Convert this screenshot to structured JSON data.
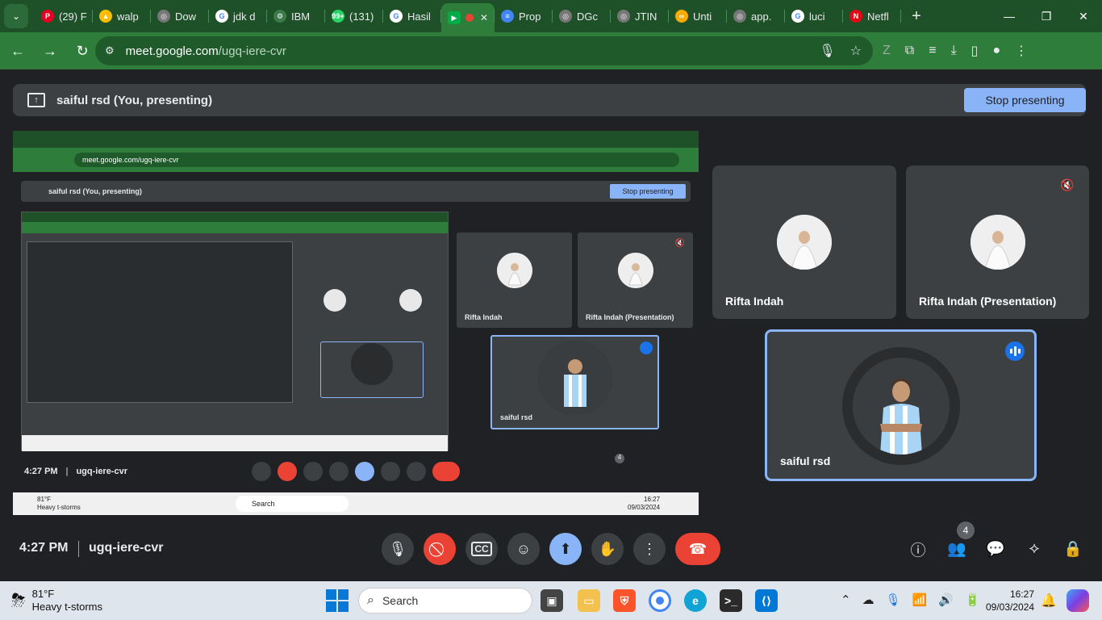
{
  "browser": {
    "tabs": [
      {
        "label": "(29) F",
        "icon": "pinterest-icon",
        "color": "#e60023",
        "glyph": "P"
      },
      {
        "label": "walp",
        "icon": "drive-icon",
        "color": "#fbbc04",
        "glyph": "▲"
      },
      {
        "label": "Dow",
        "icon": "globe-icon",
        "color": "#777777",
        "glyph": "◎"
      },
      {
        "label": "jdk d",
        "icon": "google-icon",
        "color": "#ffffff",
        "glyph": "G"
      },
      {
        "label": "IBM",
        "icon": "ibm-icon",
        "color": "#3d7a4a",
        "glyph": "⚙"
      },
      {
        "label": "(131)",
        "icon": "whatsapp-icon",
        "color": "#25d366",
        "glyph": "99+"
      },
      {
        "label": "Hasil",
        "icon": "google-icon",
        "color": "#ffffff",
        "glyph": "G"
      }
    ],
    "active_tab_close": "✕",
    "tabs_after": [
      {
        "label": "Prop",
        "icon": "docs-icon",
        "color": "#4285f4",
        "glyph": "≡"
      },
      {
        "label": "DGc",
        "icon": "globe-icon",
        "color": "#777777",
        "glyph": "◎"
      },
      {
        "label": "JTIN",
        "icon": "globe-icon",
        "color": "#777777",
        "glyph": "◎"
      },
      {
        "label": "Unti",
        "icon": "colab-icon",
        "color": "#f9ab00",
        "glyph": "∞"
      },
      {
        "label": "app.",
        "icon": "globe-icon",
        "color": "#777777",
        "glyph": "◎"
      },
      {
        "label": "luci",
        "icon": "google-icon",
        "color": "#ffffff",
        "glyph": "G"
      },
      {
        "label": "Netfl",
        "icon": "netflix-icon",
        "color": "#e50914",
        "glyph": "N"
      }
    ],
    "url_host": "meet.google.com",
    "url_path": "/ugq-iere-cvr"
  },
  "presenting_bar": {
    "text": "saiful rsd (You, presenting)",
    "stop_label": "Stop presenting"
  },
  "nested_screen": {
    "url": "meet.google.com/ugq-iere-cvr",
    "presenting_text": "saiful rsd (You, presenting)",
    "stop_label": "Stop presenting",
    "tiles": [
      {
        "name": "Rifta Indah"
      },
      {
        "name": "Rifta Indah (Presentation)"
      },
      {
        "name": "saiful rsd"
      }
    ],
    "clock": "4:27 PM",
    "meeting_code": "ugq-iere-cvr",
    "people_count": "4",
    "weather_temp": "81°F",
    "weather_desc": "Heavy t-storms",
    "search": "Search",
    "time": "16:27",
    "date": "09/03/2024"
  },
  "participants": [
    {
      "name": "Rifta Indah",
      "muted": false
    },
    {
      "name": "Rifta Indah (Presentation)",
      "muted": true
    },
    {
      "name": "saiful rsd",
      "speaking": true
    }
  ],
  "controls": {
    "clock": "4:27 PM",
    "meeting_code": "ugq-iere-cvr",
    "people_count": "4"
  },
  "taskbar": {
    "weather_temp": "81°F",
    "weather_desc": "Heavy t-storms",
    "search_placeholder": "Search",
    "time": "16:27",
    "date": "09/03/2024"
  },
  "colors": {
    "browser_green": "#2e7d3a",
    "accent_blue": "#8ab4f8",
    "end_call_red": "#ea4335",
    "tile_bg": "#3c4043"
  }
}
